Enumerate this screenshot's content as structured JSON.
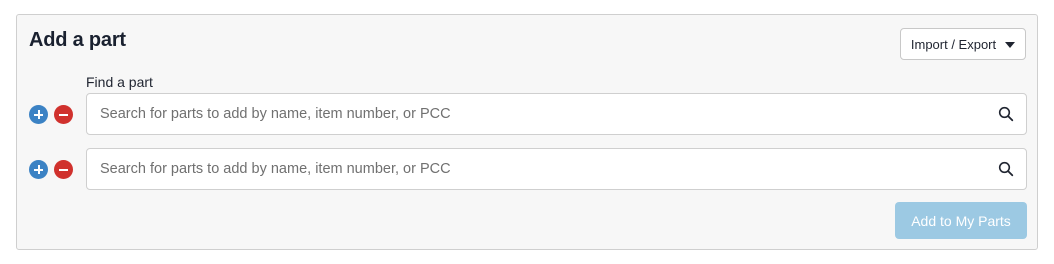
{
  "panel": {
    "title": "Add a part",
    "import_export_label": "Import / Export"
  },
  "find": {
    "label": "Find a part"
  },
  "rows": [
    {
      "placeholder": "Search for parts to add by name, item number, or PCC",
      "value": ""
    },
    {
      "placeholder": "Search for parts to add by name, item number, or PCC",
      "value": ""
    }
  ],
  "actions": {
    "add_to_my_parts_label": "Add to My Parts",
    "add_to_my_parts_disabled": true
  },
  "icons": {
    "add_row": "plus-circle-icon",
    "remove_row": "minus-circle-icon",
    "search": "search-icon",
    "dropdown": "caret-down-icon"
  },
  "colors": {
    "add_row": "#3b82c4",
    "remove_row": "#d0312d",
    "primary_disabled": "#9cc9e3",
    "panel_background": "#f7f7f7"
  }
}
